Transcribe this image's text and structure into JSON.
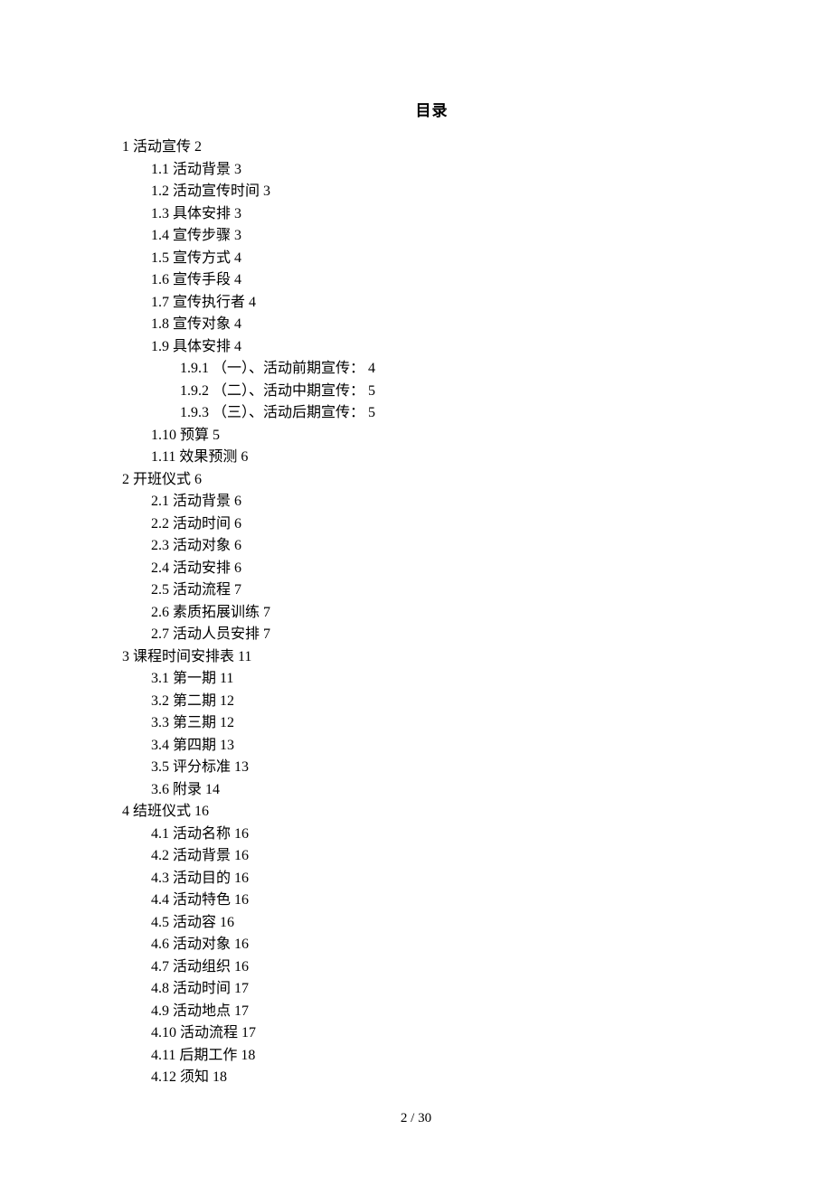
{
  "title": "目录",
  "entries": [
    {
      "level": 1,
      "num": "1",
      "text": "活动宣传",
      "page": "2"
    },
    {
      "level": 2,
      "num": "1.1",
      "text": "活动背景",
      "page": "3"
    },
    {
      "level": 2,
      "num": "1.2",
      "text": "活动宣传时间",
      "page": "3"
    },
    {
      "level": 2,
      "num": "1.3",
      "text": "具体安排",
      "page": "3"
    },
    {
      "level": 2,
      "num": "1.4",
      "text": "宣传步骤",
      "page": "3"
    },
    {
      "level": 2,
      "num": "1.5",
      "text": "宣传方式",
      "page": "4"
    },
    {
      "level": 2,
      "num": "1.6",
      "text": "宣传手段",
      "page": "4"
    },
    {
      "level": 2,
      "num": "1.7",
      "text": "宣传执行者",
      "page": "4"
    },
    {
      "level": 2,
      "num": "1.8",
      "text": "宣传对象",
      "page": "4"
    },
    {
      "level": 2,
      "num": "1.9",
      "text": "具体安排",
      "page": "4"
    },
    {
      "level": 3,
      "num": "1.9.1",
      "text": "（一）、活动前期宣传：",
      "page": "4"
    },
    {
      "level": 3,
      "num": "1.9.2",
      "text": "（二）、活动中期宣传：",
      "page": "5"
    },
    {
      "level": 3,
      "num": "1.9.3",
      "text": "（三）、活动后期宣传：",
      "page": "5"
    },
    {
      "level": 2,
      "num": "1.10",
      "text": "预算",
      "page": "5"
    },
    {
      "level": 2,
      "num": "1.11",
      "text": "效果预测",
      "page": "6"
    },
    {
      "level": 1,
      "num": "2",
      "text": "开班仪式",
      "page": "6"
    },
    {
      "level": 2,
      "num": "2.1",
      "text": "活动背景",
      "page": "6"
    },
    {
      "level": 2,
      "num": "2.2",
      "text": "活动时间",
      "page": "6"
    },
    {
      "level": 2,
      "num": "2.3",
      "text": "活动对象",
      "page": "6"
    },
    {
      "level": 2,
      "num": "2.4",
      "text": "活动安排",
      "page": "6"
    },
    {
      "level": 2,
      "num": "2.5",
      "text": "活动流程",
      "page": "7"
    },
    {
      "level": 2,
      "num": "2.6",
      "text": "素质拓展训练",
      "page": "7"
    },
    {
      "level": 2,
      "num": "2.7",
      "text": "活动人员安排",
      "page": "7"
    },
    {
      "level": 1,
      "num": "3",
      "text": "课程时间安排表",
      "page": "11"
    },
    {
      "level": 2,
      "num": "3.1",
      "text": "第一期",
      "page": "11"
    },
    {
      "level": 2,
      "num": "3.2",
      "text": "第二期",
      "page": "12"
    },
    {
      "level": 2,
      "num": "3.3",
      "text": "第三期",
      "page": "12"
    },
    {
      "level": 2,
      "num": "3.4",
      "text": "第四期",
      "page": "13"
    },
    {
      "level": 2,
      "num": "3.5",
      "text": "评分标准",
      "page": "13"
    },
    {
      "level": 2,
      "num": "3.6",
      "text": "附录",
      "page": "14"
    },
    {
      "level": 1,
      "num": "4",
      "text": "结班仪式",
      "page": "16"
    },
    {
      "level": 2,
      "num": "4.1",
      "text": "活动名称",
      "page": "16"
    },
    {
      "level": 2,
      "num": "4.2",
      "text": "活动背景",
      "page": "16"
    },
    {
      "level": 2,
      "num": "4.3",
      "text": "活动目的",
      "page": "16"
    },
    {
      "level": 2,
      "num": "4.4",
      "text": "活动特色",
      "page": "16"
    },
    {
      "level": 2,
      "num": "4.5",
      "text": "活动容",
      "page": "16"
    },
    {
      "level": 2,
      "num": "4.6",
      "text": "活动对象",
      "page": "16"
    },
    {
      "level": 2,
      "num": "4.7",
      "text": "活动组织",
      "page": "16"
    },
    {
      "level": 2,
      "num": "4.8",
      "text": "活动时间",
      "page": "17"
    },
    {
      "level": 2,
      "num": "4.9",
      "text": "活动地点",
      "page": "17"
    },
    {
      "level": 2,
      "num": "4.10",
      "text": "活动流程",
      "page": "17"
    },
    {
      "level": 2,
      "num": "4.11",
      "text": "后期工作",
      "page": "18"
    },
    {
      "level": 2,
      "num": "4.12",
      "text": "须知",
      "page": "18"
    }
  ],
  "pageNumber": "2 / 30"
}
